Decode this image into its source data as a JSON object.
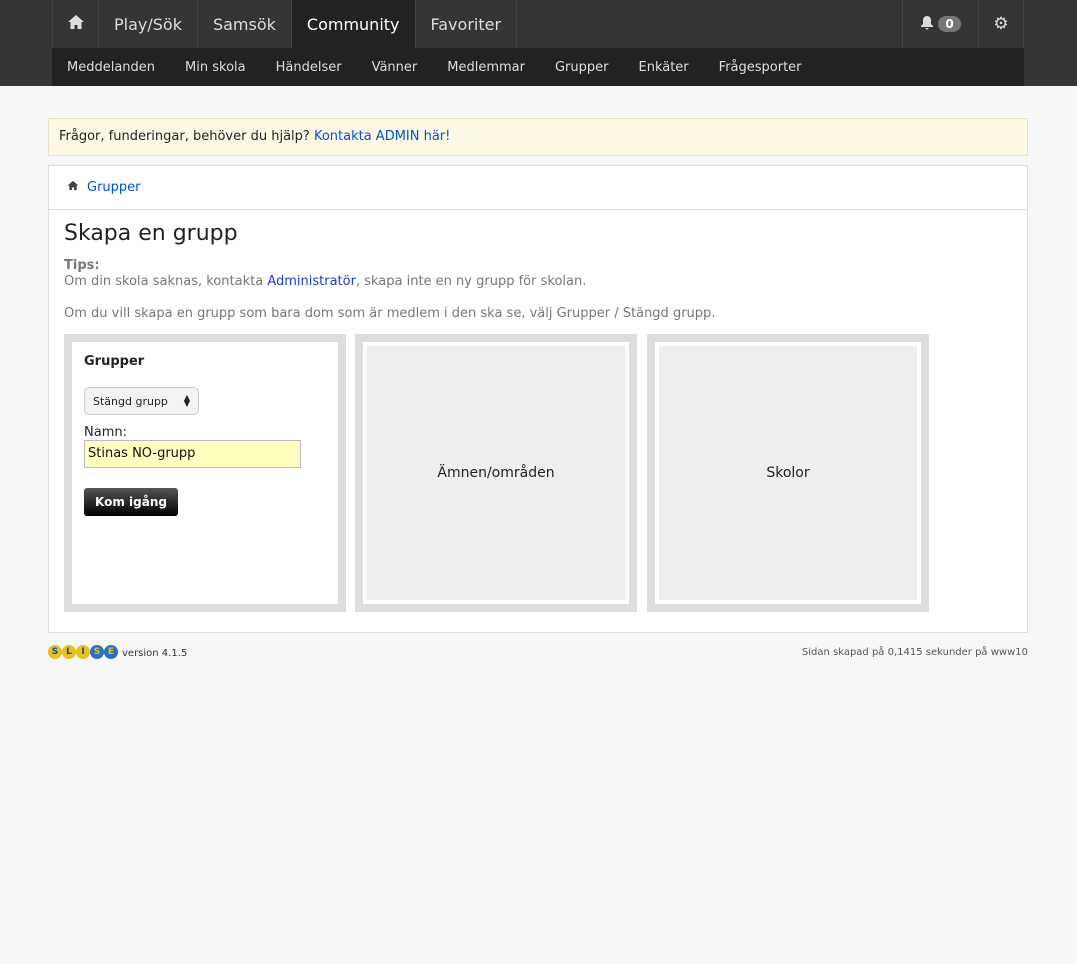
{
  "nav": {
    "items": [
      {
        "label": "Play/Sök"
      },
      {
        "label": "Samsök"
      },
      {
        "label": "Community",
        "active": true
      },
      {
        "label": "Favoriter"
      }
    ],
    "notifications": "0"
  },
  "subnav": [
    "Meddelanden",
    "Min skola",
    "Händelser",
    "Vänner",
    "Medlemmar",
    "Grupper",
    "Enkäter",
    "Frågesporter"
  ],
  "notice": {
    "text": "Frågor, funderingar, behöver du hjälp? ",
    "link": "Kontakta ADMIN här!"
  },
  "breadcrumb": "Grupper",
  "title": "Skapa en grupp",
  "tips": {
    "label": "Tips:",
    "before": "Om din skola saknas, kontakta ",
    "link": "Administratör",
    "after": ", skapa inte en ny grupp för skolan."
  },
  "info": "Om du vill skapa en grupp som bara dom som är medlem i den ska se, välj Grupper / Stängd grupp.",
  "form": {
    "heading": "Grupper",
    "select": "Stängd grupp",
    "name_label": "Namn:",
    "name_value": "Stinas NO-grupp",
    "submit": "Kom igång"
  },
  "boxes": [
    "Ämnen/områden",
    "Skolor"
  ],
  "footer": {
    "logo": "SLISE",
    "version": "version 4.1.5",
    "generated": "Sidan skapad på 0,1415 sekunder på www10"
  }
}
